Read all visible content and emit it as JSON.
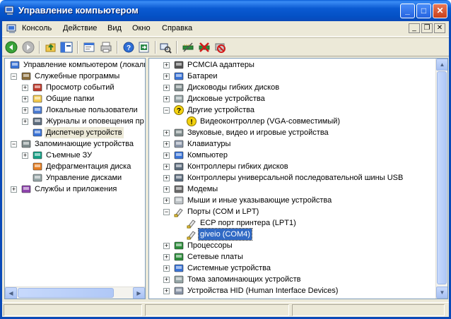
{
  "window": {
    "title": "Управление компьютером",
    "buttons": {
      "minimize": "_",
      "maximize": "□",
      "close": "✕"
    }
  },
  "menubar": {
    "items": [
      "Консоль",
      "Действие",
      "Вид",
      "Окно",
      "Справка"
    ],
    "mdi_buttons": [
      "_",
      "❐",
      "✕"
    ]
  },
  "toolbar": {
    "buttons": [
      "back",
      "forward",
      "up-one-level",
      "show-hide-tree",
      "properties",
      "print",
      "help",
      "export-list",
      "scan-hardware",
      "update-driver",
      "disable-device",
      "uninstall-device"
    ]
  },
  "left_tree": {
    "items": [
      {
        "label": "Управление компьютером (локаль",
        "icon": "computer-management-icon",
        "expander": "",
        "level": 0
      },
      {
        "label": "Служебные программы",
        "icon": "tools-icon",
        "expander": "−",
        "level": 1
      },
      {
        "label": "Просмотр событий",
        "icon": "event-viewer-icon",
        "expander": "+",
        "level": 2
      },
      {
        "label": "Общие папки",
        "icon": "shared-folders-icon",
        "expander": "+",
        "level": 2
      },
      {
        "label": "Локальные пользователи",
        "icon": "users-icon",
        "expander": "+",
        "level": 2
      },
      {
        "label": "Журналы и оповещения пр",
        "icon": "logs-icon",
        "expander": "+",
        "level": 2
      },
      {
        "label": "Диспетчер устройств",
        "icon": "device-manager-icon",
        "expander": "",
        "level": 2,
        "selected": true
      },
      {
        "label": "Запоминающие устройства",
        "icon": "storage-icon",
        "expander": "−",
        "level": 1
      },
      {
        "label": "Съемные ЗУ",
        "icon": "removable-storage-icon",
        "expander": "+",
        "level": 2
      },
      {
        "label": "Дефрагментация диска",
        "icon": "defrag-icon",
        "expander": "",
        "level": 2
      },
      {
        "label": "Управление дисками",
        "icon": "disk-management-icon",
        "expander": "",
        "level": 2
      },
      {
        "label": "Службы и приложения",
        "icon": "services-icon",
        "expander": "+",
        "level": 1
      }
    ]
  },
  "device_tree": {
    "items": [
      {
        "label": "PCMCIA адаптеры",
        "icon": "pcmcia-icon",
        "expander": "+",
        "level": 0
      },
      {
        "label": "Батареи",
        "icon": "battery-icon",
        "expander": "+",
        "level": 0
      },
      {
        "label": "Дисководы гибких дисков",
        "icon": "floppy-drive-icon",
        "expander": "+",
        "level": 0
      },
      {
        "label": "Дисковые устройства",
        "icon": "disk-drive-icon",
        "expander": "+",
        "level": 0
      },
      {
        "label": "Другие устройства",
        "icon": "unknown-device-icon",
        "expander": "−",
        "level": 0
      },
      {
        "label": "Видеоконтроллер (VGA-совместимый)",
        "icon": "warning-device-icon",
        "expander": "",
        "level": 1
      },
      {
        "label": "Звуковые, видео и игровые устройства",
        "icon": "sound-icon",
        "expander": "+",
        "level": 0
      },
      {
        "label": "Клавиатуры",
        "icon": "keyboard-icon",
        "expander": "+",
        "level": 0
      },
      {
        "label": "Компьютер",
        "icon": "computer-icon",
        "expander": "+",
        "level": 0
      },
      {
        "label": "Контроллеры гибких дисков",
        "icon": "floppy-controller-icon",
        "expander": "+",
        "level": 0
      },
      {
        "label": "Контроллеры универсальной последовательной шины USB",
        "icon": "usb-icon",
        "expander": "+",
        "level": 0
      },
      {
        "label": "Модемы",
        "icon": "modem-icon",
        "expander": "+",
        "level": 0
      },
      {
        "label": "Мыши и иные указывающие устройства",
        "icon": "mouse-icon",
        "expander": "+",
        "level": 0
      },
      {
        "label": "Порты (COM и LPT)",
        "icon": "ports-icon",
        "expander": "−",
        "level": 0
      },
      {
        "label": "ECP порт принтера (LPT1)",
        "icon": "port-icon",
        "expander": "",
        "level": 1
      },
      {
        "label": "giveio (COM4)",
        "icon": "port-icon",
        "expander": "",
        "level": 1,
        "selected": true
      },
      {
        "label": "Процессоры",
        "icon": "processor-icon",
        "expander": "+",
        "level": 0
      },
      {
        "label": "Сетевые платы",
        "icon": "network-card-icon",
        "expander": "+",
        "level": 0
      },
      {
        "label": "Системные устройства",
        "icon": "system-devices-icon",
        "expander": "+",
        "level": 0
      },
      {
        "label": "Тома запоминающих устройств",
        "icon": "storage-volume-icon",
        "expander": "+",
        "level": 0
      },
      {
        "label": "Устройства HID (Human Interface Devices)",
        "icon": "hid-icon",
        "expander": "+",
        "level": 0
      }
    ]
  },
  "colors": {
    "titlebar": "#0a5ad2",
    "face": "#ece9d8",
    "selection": "#316ac5"
  }
}
